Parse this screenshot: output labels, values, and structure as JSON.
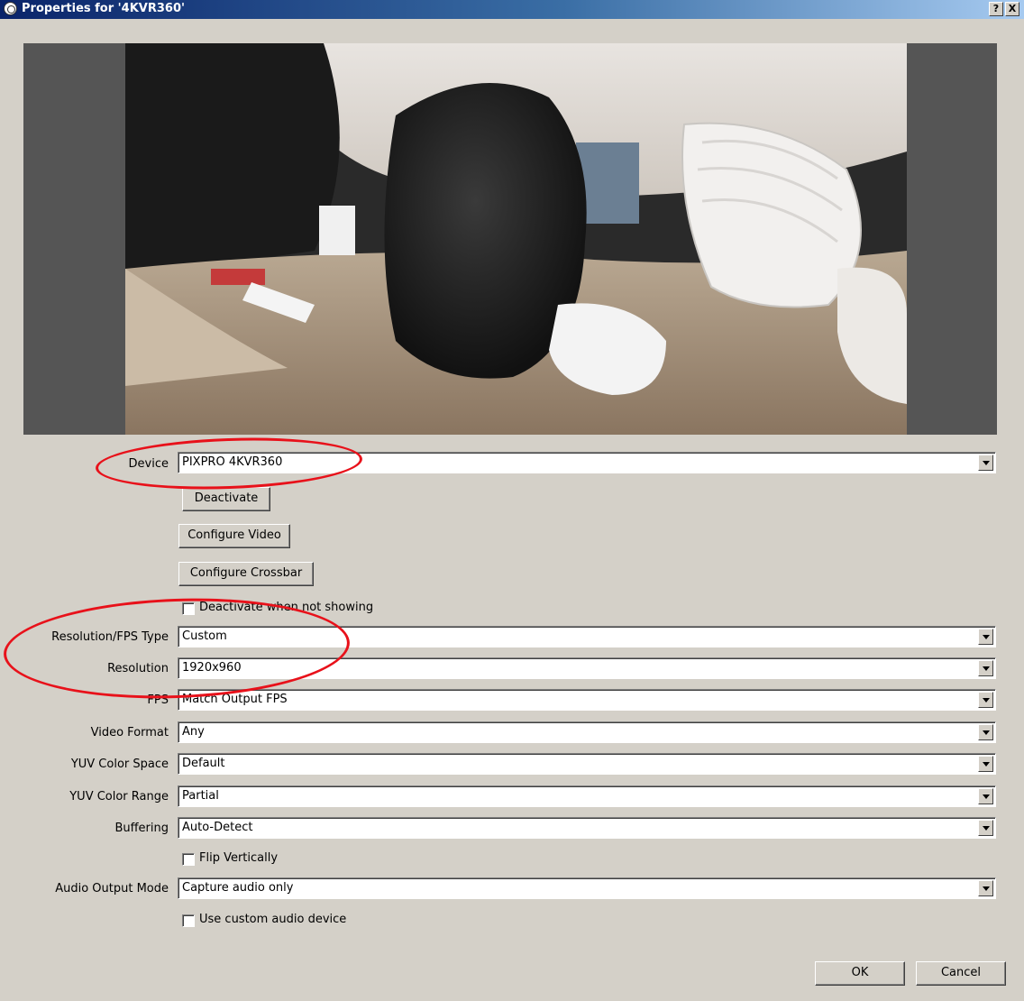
{
  "window": {
    "title": "Properties for '4KVR360'",
    "help_button": "?",
    "close_button": "X"
  },
  "preview": {
    "icon": "camera-preview-image"
  },
  "fields": {
    "device": {
      "label": "Device",
      "value": "PIXPRO 4KVR360"
    },
    "res_fps_type": {
      "label": "Resolution/FPS Type",
      "value": "Custom"
    },
    "resolution": {
      "label": "Resolution",
      "value": "1920x960"
    },
    "fps": {
      "label": "FPS",
      "value": "Match Output FPS"
    },
    "video_format": {
      "label": "Video Format",
      "value": "Any"
    },
    "yuv_space": {
      "label": "YUV Color Space",
      "value": "Default"
    },
    "yuv_range": {
      "label": "YUV Color Range",
      "value": "Partial"
    },
    "buffering": {
      "label": "Buffering",
      "value": "Auto-Detect"
    },
    "audio_mode": {
      "label": "Audio Output Mode",
      "value": "Capture audio only"
    }
  },
  "buttons": {
    "deactivate": "Deactivate",
    "configure_video": "Configure Video",
    "configure_crossbar": "Configure Crossbar",
    "ok": "OK",
    "cancel": "Cancel"
  },
  "checkboxes": {
    "deactivate_hidden": {
      "label": "Deactivate when not showing",
      "checked": false
    },
    "flip_vertically": {
      "label": "Flip Vertically",
      "checked": false
    },
    "custom_audio": {
      "label": "Use custom audio device",
      "checked": false
    }
  },
  "annotations": {
    "color": "#e8111a"
  },
  "colors": {
    "dialog_bg": "#d4d0c8",
    "titlebar_start": "#0a246a",
    "titlebar_end": "#a6caf0",
    "preview_bg": "#555555"
  }
}
